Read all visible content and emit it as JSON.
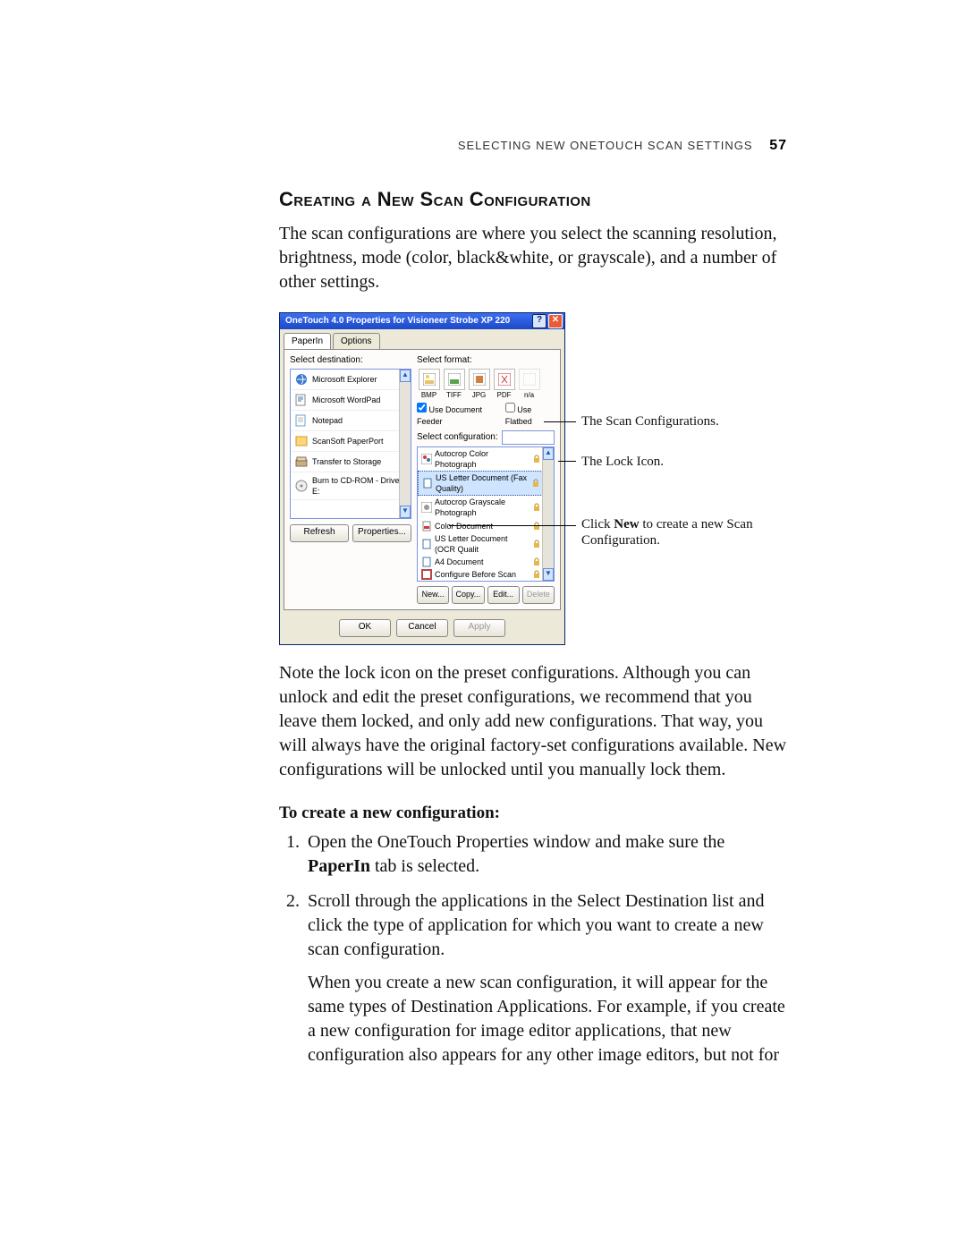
{
  "header": {
    "running": "Selecting New OneTouch Scan Settings",
    "page_number": "57"
  },
  "section_heading": "Creating a New Scan Configuration",
  "intro_para": "The scan configurations are where you select the scanning resolution, brightness, mode (color, black&white, or grayscale), and a number of other settings.",
  "note_para": "Note the lock icon on the preset configurations. Although you can unlock and edit the preset configurations, we recommend that you leave them locked, and only add new configurations. That way, you will always have the original factory-set configurations available. New configurations will be unlocked until you manually lock them.",
  "subhead": "To create a new configuration:",
  "steps": {
    "s1a": "Open the OneTouch Properties window and make sure the ",
    "s1b": "PaperIn",
    "s1c": " tab is selected.",
    "s2": "Scroll through the applications in the Select Destination list and click the type of application for which you want to create a new scan configuration.",
    "s2_extra": "When you create a new scan configuration, it will appear for the same types of Destination Applications. For example, if you create a new configuration for image editor applications, that new configuration also appears for any other image editors, but not for"
  },
  "callouts": {
    "c1": "The Scan Configurations.",
    "c2": "The Lock Icon.",
    "c3a": "Click ",
    "c3b": "New",
    "c3c": " to create a new Scan Configuration."
  },
  "dialog": {
    "title": "OneTouch 4.0 Properties for Visioneer Strobe XP 220",
    "tabs": {
      "paperin": "PaperIn",
      "options": "Options"
    },
    "left": {
      "label": "Select destination:",
      "items": [
        "Microsoft Explorer",
        "Microsoft WordPad",
        "Notepad",
        "ScanSoft PaperPort",
        "Transfer to Storage",
        "Burn to CD-ROM - Drive E:"
      ],
      "refresh": "Refresh",
      "properties": "Properties..."
    },
    "right": {
      "label_format": "Select format:",
      "formats": [
        "BMP",
        "TIFF",
        "JPG",
        "PDF",
        "n/a"
      ],
      "use_doc_feeder": "Use Document Feeder",
      "use_flatbed": "Use Flatbed",
      "label_config": "Select configuration:",
      "configs": [
        "Autocrop Color Photograph",
        "US Letter Document (Fax Quality)",
        "Autocrop Grayscale Photograph",
        "Color Document",
        "US Letter Document (OCR Qualit",
        "A4 Document",
        "Configure Before Scan"
      ],
      "new": "New...",
      "copy": "Copy...",
      "edit": "Edit...",
      "delete": "Delete"
    },
    "bottom": {
      "ok": "OK",
      "cancel": "Cancel",
      "apply": "Apply"
    }
  }
}
